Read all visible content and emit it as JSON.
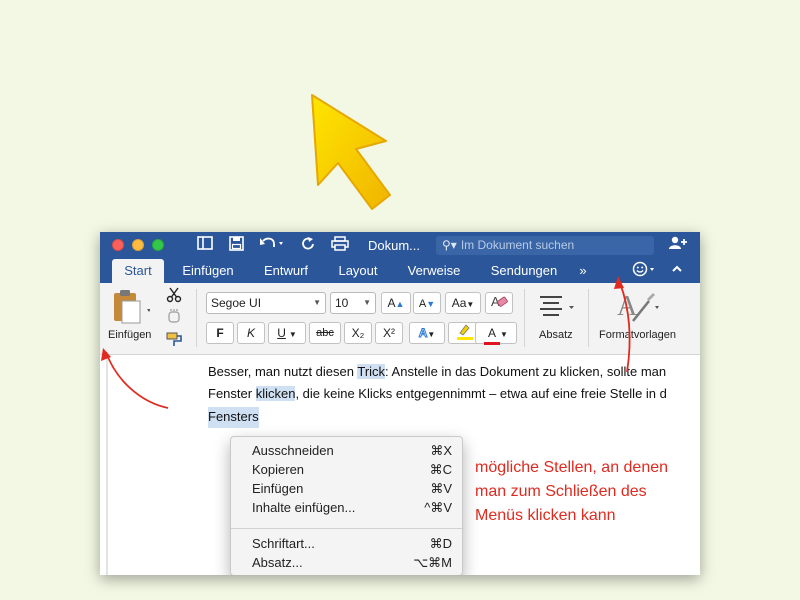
{
  "window": {
    "document_title": "Dokum...",
    "search_placeholder": "Im Dokument suchen"
  },
  "tabs": [
    {
      "label": "Start",
      "active": true
    },
    {
      "label": "Einfügen",
      "active": false
    },
    {
      "label": "Entwurf",
      "active": false
    },
    {
      "label": "Layout",
      "active": false
    },
    {
      "label": "Verweise",
      "active": false
    },
    {
      "label": "Sendungen",
      "active": false
    }
  ],
  "tabs_more": "»",
  "ribbon": {
    "paste_label": "Einfügen",
    "font_name": "Segoe UI",
    "font_size": "10",
    "bold": "F",
    "italic": "K",
    "underline": "U",
    "strikethrough": "abc",
    "subscript": "X₂",
    "superscript": "X²",
    "paragraph_label": "Absatz",
    "styles_label": "Formatvorlagen"
  },
  "document": {
    "line1": {
      "a": "Besser, man nutzt diesen ",
      "b": "Trick",
      "c": ": Anstelle in das Dokument zu klicken, sollte man"
    },
    "line2": {
      "a": "Fenster ",
      "b": "klicken",
      "c": ", die keine Klicks entgegennimmt – etwa auf eine freie Stelle in d"
    },
    "line3": "Fensters"
  },
  "context_menu": [
    {
      "label": "Ausschneiden",
      "shortcut": "⌘X"
    },
    {
      "label": "Kopieren",
      "shortcut": "⌘C"
    },
    {
      "label": "Einfügen",
      "shortcut": "⌘V"
    },
    {
      "label": "Inhalte einfügen...",
      "shortcut": "^⌘V"
    },
    {
      "label": "Schriftart...",
      "shortcut": "⌘D"
    },
    {
      "label": "Absatz...",
      "shortcut": "⌥⌘M"
    }
  ],
  "annotation": {
    "line1": "mögliche Stellen, an denen",
    "line2": "man zum Schließen des",
    "line3": "Menüs klicken kann"
  },
  "colors": {
    "word_blue": "#2b579a",
    "annotation_red": "#e02a1f",
    "background": "#f2f8e3",
    "cursor_yellow": "#f5c400"
  }
}
